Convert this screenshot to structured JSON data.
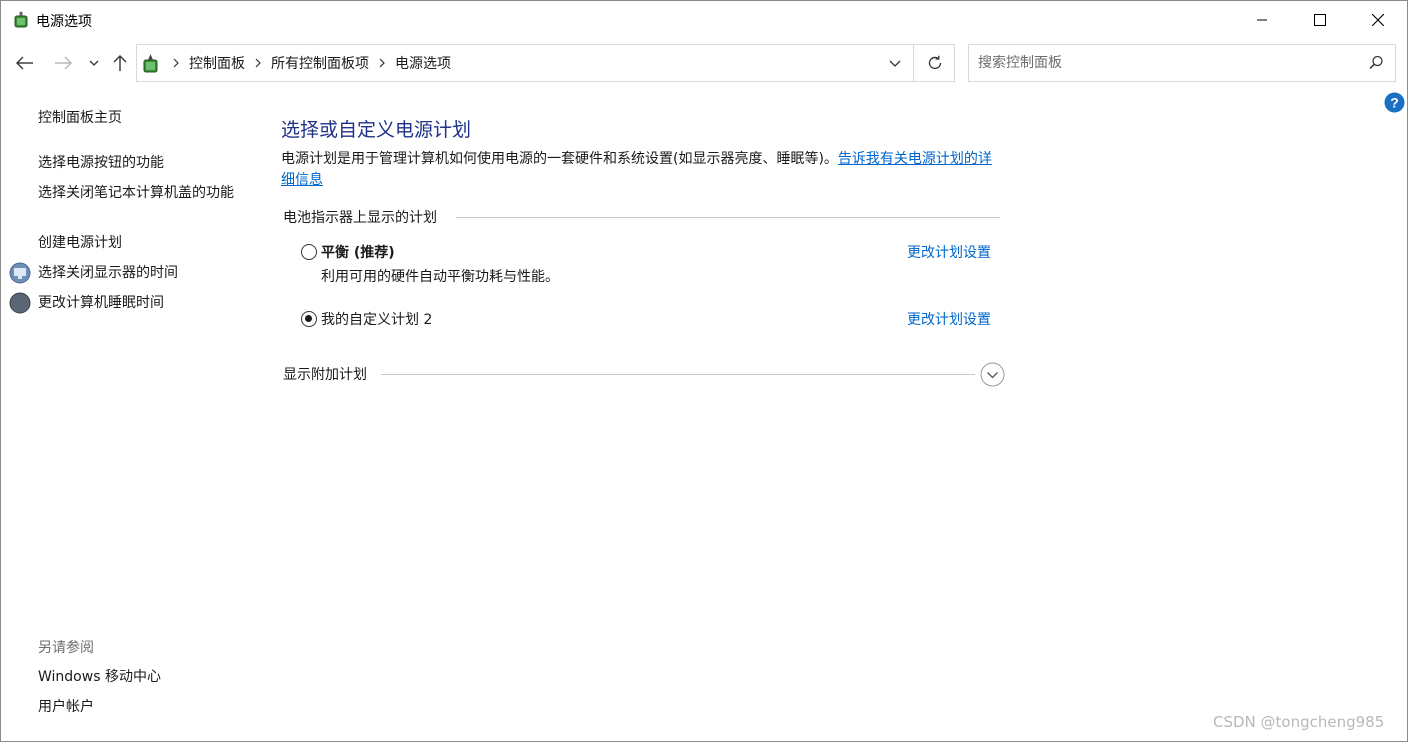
{
  "window": {
    "title": "电源选项",
    "icon": "power-options-icon"
  },
  "nav": {
    "back_icon": "arrow-left-icon",
    "forward_icon": "arrow-right-icon",
    "recent_icon": "chevron-down-icon",
    "up_icon": "arrow-up-icon"
  },
  "address": {
    "crumbs": [
      "控制面板",
      "所有控制面板项",
      "电源选项"
    ]
  },
  "search": {
    "placeholder": "搜索控制面板"
  },
  "sidebar": {
    "home_link": "控制面板主页",
    "links": [
      {
        "label": "选择电源按钮的功能"
      },
      {
        "label": "选择关闭笔记本计算机盖的功能"
      },
      {
        "label": "创建电源计划"
      },
      {
        "label": "选择关闭显示器的时间",
        "icon": "monitor-icon"
      },
      {
        "label": "更改计算机睡眠时间",
        "icon": "moon-icon"
      }
    ],
    "see_also_heading": "另请参阅",
    "see_also": [
      {
        "label": "Windows 移动中心"
      },
      {
        "label": "用户帐户"
      }
    ]
  },
  "main": {
    "title": "选择或自定义电源计划",
    "description": "电源计划是用于管理计算机如何使用电源的一套硬件和系统设置(如显示器亮度、睡眠等)。",
    "description_link": "告诉我有关电源计划的详细信息",
    "group_label": "电池指示器上显示的计划",
    "plans": [
      {
        "name": "平衡 (推荐)",
        "description": "利用可用的硬件自动平衡功耗与性能。",
        "selected": false,
        "link": "更改计划设置"
      },
      {
        "name": "我的自定义计划 2",
        "description": "",
        "selected": true,
        "link": "更改计划设置"
      }
    ],
    "more_plans_label": "显示附加计划"
  },
  "watermark": "CSDN @tongcheng985",
  "colors": {
    "title_blue": "#1e3287",
    "link_blue": "#0066cc",
    "help_blue": "#1a6fc4"
  }
}
